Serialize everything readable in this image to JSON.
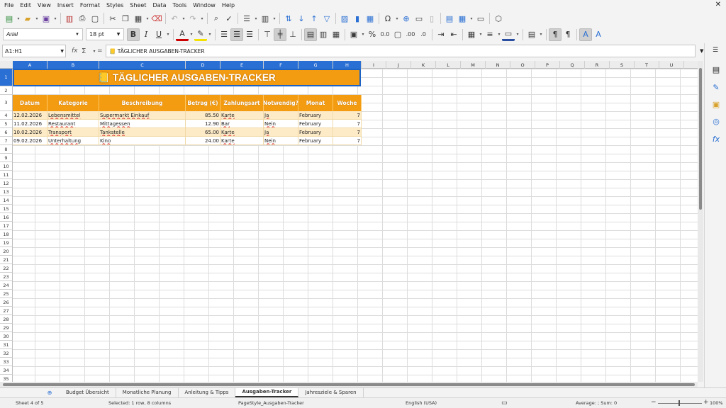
{
  "menu": [
    "File",
    "Edit",
    "View",
    "Insert",
    "Format",
    "Styles",
    "Sheet",
    "Data",
    "Tools",
    "Window",
    "Help"
  ],
  "toolbar": {
    "font_name": "Arial",
    "font_size": "18 pt"
  },
  "formula_bar": {
    "name_box": "A1:H1",
    "content": "📒 TÄGLICHER AUSGABEN-TRACKER"
  },
  "columns": [
    "A",
    "B",
    "C",
    "D",
    "E",
    "F",
    "G",
    "H",
    "I",
    "J",
    "K",
    "L",
    "M",
    "N",
    "O",
    "P",
    "Q",
    "R",
    "S",
    "T",
    "U"
  ],
  "rows": [
    "1",
    "2",
    "3",
    "4",
    "5",
    "6",
    "7",
    "8",
    "9",
    "10",
    "11",
    "12",
    "13",
    "14",
    "15",
    "16",
    "17",
    "18",
    "19",
    "20",
    "21",
    "22",
    "23",
    "24",
    "25",
    "26",
    "27",
    "28",
    "29",
    "30",
    "31",
    "32",
    "33",
    "34",
    "35"
  ],
  "sheet": {
    "banner": "📒 TÄGLICHER AUSGABEN-TRACKER",
    "headers": [
      "Datum",
      "Kategorie",
      "Beschreibung",
      "Betrag (€)",
      "Zahlungsart",
      "Notwendig?",
      "Monat",
      "Woche"
    ],
    "data": [
      {
        "datum": "12.02.2026",
        "kategorie": "Lebensmittel",
        "beschreibung": "Supermarkt Einkauf",
        "betrag": "85.50",
        "zahlungsart": "Karte",
        "notwendig": "Ja",
        "monat": "February",
        "woche": "7"
      },
      {
        "datum": "11.02.2026",
        "kategorie": "Restaurant",
        "beschreibung": "Mittagessen",
        "betrag": "12.90",
        "zahlungsart": "Bar",
        "notwendig": "Nein",
        "monat": "February",
        "woche": "7"
      },
      {
        "datum": "10.02.2026",
        "kategorie": "Transport",
        "beschreibung": "Tankstelle",
        "betrag": "65.00",
        "zahlungsart": "Karte",
        "notwendig": "Ja",
        "monat": "February",
        "woche": "7"
      },
      {
        "datum": "09.02.2026",
        "kategorie": "Unterhaltung",
        "beschreibung": "Kino",
        "betrag": "24.00",
        "zahlungsart": "Karte",
        "notwendig": "Nein",
        "monat": "February",
        "woche": "7"
      }
    ]
  },
  "tabs": [
    "Budget Übersicht",
    "Monatliche Planung",
    "Anleitung & Tipps",
    "Ausgaben-Tracker",
    "Jahresziele & Sparen"
  ],
  "active_tab": "Ausgaben-Tracker",
  "status": {
    "sheet": "Sheet 4 of 5",
    "selection": "Selected: 1 row, 8 columns",
    "page_style": "PageStyle_Ausgaben-Tracker",
    "language": "English (USA)",
    "summary": "Average: ; Sum: 0",
    "zoom": "100%"
  },
  "colors": {
    "accent": "#f39c12",
    "selection": "#2a6fd3",
    "stripe": "#fdebc8"
  }
}
